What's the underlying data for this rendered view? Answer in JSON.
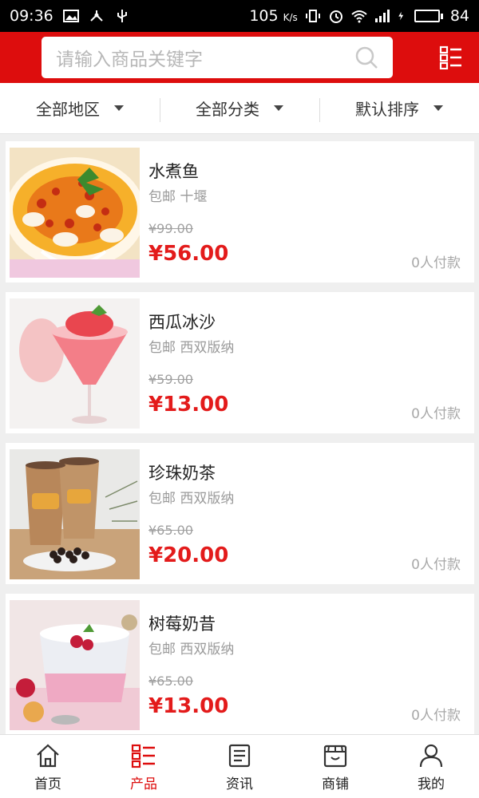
{
  "status": {
    "time": "09:36",
    "speed": "105",
    "speed_unit": "K/s",
    "battery": "84",
    "battery_level": 0.84
  },
  "search": {
    "placeholder": "请输入商品关键字"
  },
  "filters": [
    {
      "label": "全部地区"
    },
    {
      "label": "全部分类"
    },
    {
      "label": "默认排序"
    }
  ],
  "products": [
    {
      "name": "水煮鱼",
      "sub": "包邮 十堰",
      "old_price": "¥99.00",
      "price": "¥56.00",
      "sales": "0人付款"
    },
    {
      "name": "西瓜冰沙",
      "sub": "包邮 西双版纳",
      "old_price": "¥59.00",
      "price": "¥13.00",
      "sales": "0人付款"
    },
    {
      "name": "珍珠奶茶",
      "sub": "包邮 西双版纳",
      "old_price": "¥65.00",
      "price": "¥20.00",
      "sales": "0人付款"
    },
    {
      "name": "树莓奶昔",
      "sub": "包邮 西双版纳",
      "old_price": "¥65.00",
      "price": "¥13.00",
      "sales": "0人付款"
    }
  ],
  "tabs": [
    {
      "label": "首页",
      "icon": "home-icon"
    },
    {
      "label": "产品",
      "icon": "list-icon",
      "active": true
    },
    {
      "label": "资讯",
      "icon": "news-icon"
    },
    {
      "label": "商铺",
      "icon": "shop-icon"
    },
    {
      "label": "我的",
      "icon": "user-icon"
    }
  ],
  "colors": {
    "brand_red": "#dd0d0d",
    "price_red": "#e31b1b"
  }
}
